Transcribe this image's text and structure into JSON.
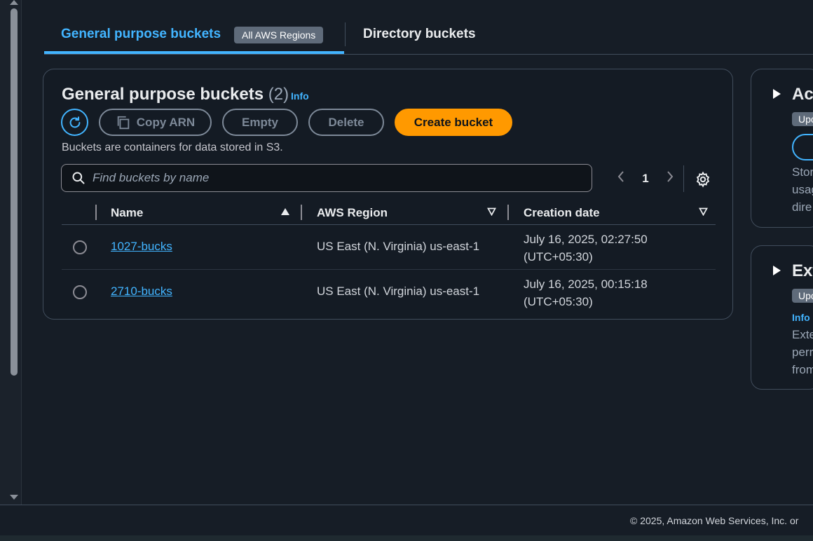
{
  "tabs": {
    "general_purpose": {
      "label": "General purpose buckets",
      "badge": "All AWS Regions"
    },
    "directory": {
      "label": "Directory buckets"
    }
  },
  "panel": {
    "title": "General purpose buckets",
    "count": "(2)",
    "info": "Info",
    "description": "Buckets are containers for data stored in S3.",
    "buttons": {
      "copy_arn": "Copy ARN",
      "empty": "Empty",
      "delete": "Delete",
      "create": "Create bucket"
    },
    "search": {
      "placeholder": "Find buckets by name",
      "value": ""
    },
    "pagination": {
      "page": "1"
    },
    "columns": {
      "name": "Name",
      "region": "AWS Region",
      "creation_date": "Creation date"
    },
    "rows": [
      {
        "name": "1027-bucks",
        "region": "US East (N. Virginia) us-east-1",
        "date_line1": "July 16, 2025, 02:27:50",
        "date_line2": "(UTC+05:30)"
      },
      {
        "name": "2710-bucks",
        "region": "US East (N. Virginia) us-east-1",
        "date_line1": "July 16, 2025, 00:15:18",
        "date_line2": "(UTC+05:30)"
      }
    ]
  },
  "side_cards": [
    {
      "title": "Acc",
      "badge": "Upc",
      "lines": [
        "Stor",
        "usag",
        "dire"
      ]
    },
    {
      "title": "Ext",
      "badge": "Upc",
      "info": "Info",
      "lines": [
        "Exte",
        "perr",
        "from"
      ]
    }
  ],
  "footer": {
    "copyright": "© 2025, Amazon Web Services, Inc. or"
  },
  "colors": {
    "accent": "#42b4ff",
    "primary_button": "#ff9900",
    "background": "#161d26"
  }
}
